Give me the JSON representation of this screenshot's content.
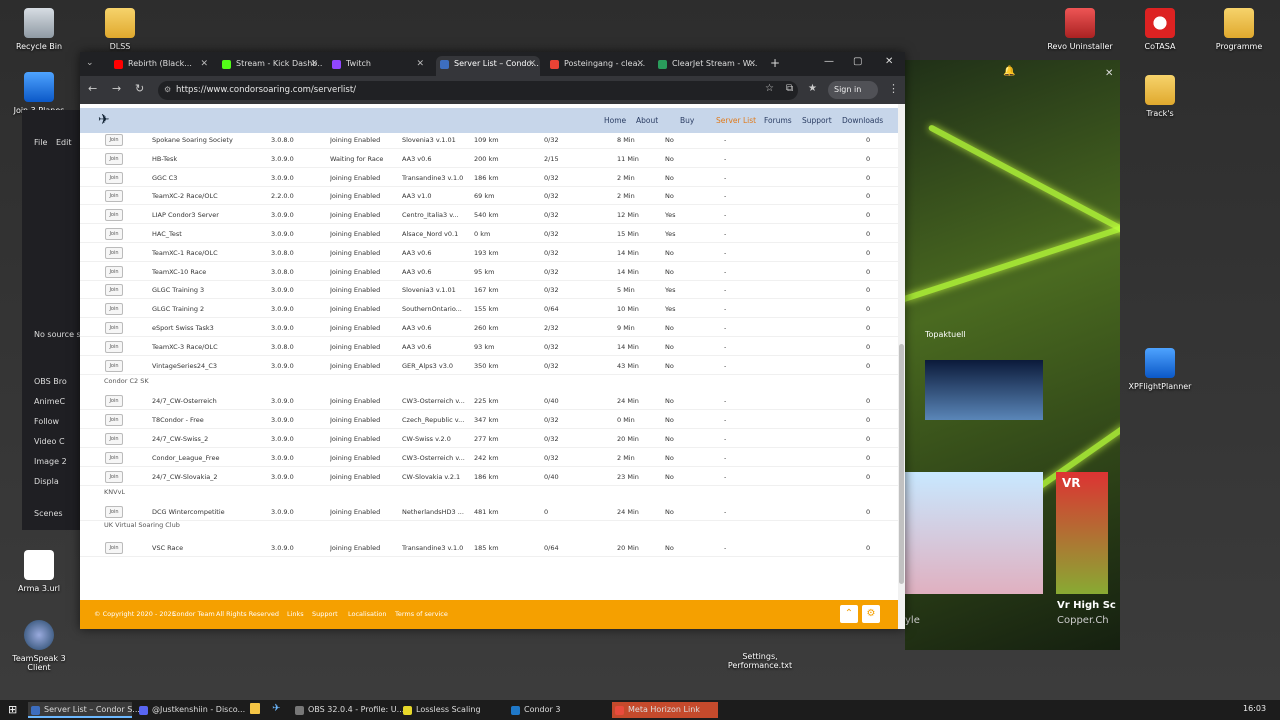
{
  "desktop": {
    "left_icons": [
      "Recycle Bin",
      "DLSS",
      "Join 3 Planes",
      "Arma 3.url",
      "TeamSpeak 3 Client"
    ],
    "right_icons": [
      "Revo Uninstaller",
      "CoTASA",
      "Programme",
      "Track's",
      "XPFlightPlanner",
      "Settings, Performance.txt"
    ]
  },
  "obs": {
    "menu": [
      "File",
      "Edit"
    ],
    "items": [
      "OBS Bro",
      "AnimeC",
      "Follow",
      "Video C",
      "Image 2",
      "Displa"
    ],
    "no_source": "No source s",
    "scenes_label": "Scenes"
  },
  "game": {
    "label": "Topaktuell",
    "vr_label": "VR",
    "promo_title": "Vr High Sc",
    "promo_sub": "Copper.Ch",
    "small": "yle"
  },
  "browser": {
    "tabs": [
      {
        "label": "Rebirth (Black...",
        "color": "#ff0000"
      },
      {
        "label": "Stream - Kick Dashb...",
        "color": "#53fc18"
      },
      {
        "label": "Twitch",
        "color": "#9146ff"
      },
      {
        "label": "Server List – Condo...",
        "color": "#3d6ebf",
        "active": true
      },
      {
        "label": "Posteingang - clea...",
        "color": "#ea4335"
      },
      {
        "label": "ClearJet Stream - W...",
        "color": "#2a9d5c"
      }
    ],
    "url": "https://www.condorsoaring.com/serverlist/",
    "signin": "Sign in",
    "nav": [
      "Home",
      "About",
      "Buy",
      "Server List",
      "Forums",
      "Support",
      "Downloads"
    ]
  },
  "servers": [
    {
      "name": "Spokane Soaring Society",
      "version": "3.0.8.0",
      "status": "Joining Enabled",
      "scenery": "Slovenia3 v.1.01",
      "dist": "109 km",
      "players": "0/32",
      "time": "8 Min",
      "pw": "No",
      "ext": "-",
      "ping": "0"
    },
    {
      "name": "HB-Tesk",
      "version": "3.0.9.0",
      "status": "Waiting for Race",
      "scenery": "AA3 v0.6",
      "dist": "200 km",
      "players": "2/15",
      "time": "11 Min",
      "pw": "No",
      "ext": "-",
      "ping": "0"
    },
    {
      "name": "GGC C3",
      "version": "3.0.9.0",
      "status": "Joining Enabled",
      "scenery": "Transandine3 v.1.0",
      "dist": "186 km",
      "players": "0/32",
      "time": "2 Min",
      "pw": "No",
      "ext": "-",
      "ping": "0"
    },
    {
      "name": "TeamXC-2 Race/OLC",
      "version": "2.2.0.0",
      "status": "Joining Enabled",
      "scenery": "AA3 v1.0",
      "dist": "69 km",
      "players": "0/32",
      "time": "2 Min",
      "pw": "No",
      "ext": "-",
      "ping": "0"
    },
    {
      "name": "LIAP Condor3 Server",
      "version": "3.0.9.0",
      "status": "Joining Enabled",
      "scenery": "Centro_Italia3 v...",
      "dist": "540 km",
      "players": "0/32",
      "time": "12 Min",
      "pw": "Yes",
      "ext": "-",
      "ping": "0"
    },
    {
      "name": "HAC_Test",
      "version": "3.0.9.0",
      "status": "Joining Enabled",
      "scenery": "Alsace_Nord v0.1",
      "dist": "0 km",
      "players": "0/32",
      "time": "15 Min",
      "pw": "Yes",
      "ext": "-",
      "ping": "0"
    },
    {
      "name": "TeamXC-1 Race/OLC",
      "version": "3.0.8.0",
      "status": "Joining Enabled",
      "scenery": "AA3 v0.6",
      "dist": "193 km",
      "players": "0/32",
      "time": "14 Min",
      "pw": "No",
      "ext": "-",
      "ping": "0"
    },
    {
      "name": "TeamXC-10 Race",
      "version": "3.0.8.0",
      "status": "Joining Enabled",
      "scenery": "AA3 v0.6",
      "dist": "95 km",
      "players": "0/32",
      "time": "14 Min",
      "pw": "No",
      "ext": "-",
      "ping": "0"
    },
    {
      "name": "GLGC Training 3",
      "version": "3.0.9.0",
      "status": "Joining Enabled",
      "scenery": "Slovenia3 v.1.01",
      "dist": "167 km",
      "players": "0/32",
      "time": "5 Min",
      "pw": "Yes",
      "ext": "-",
      "ping": "0"
    },
    {
      "name": "GLGC Training 2",
      "version": "3.0.9.0",
      "status": "Joining Enabled",
      "scenery": "SouthernOntario...",
      "dist": "155 km",
      "players": "0/64",
      "time": "10 Min",
      "pw": "Yes",
      "ext": "-",
      "ping": "0"
    },
    {
      "name": "eSport Swiss Task3",
      "version": "3.0.9.0",
      "status": "Joining Enabled",
      "scenery": "AA3 v0.6",
      "dist": "260 km",
      "players": "2/32",
      "time": "9 Min",
      "pw": "No",
      "ext": "-",
      "ping": "0"
    },
    {
      "name": "TeamXC-3 Race/OLC",
      "version": "3.0.8.0",
      "status": "Joining Enabled",
      "scenery": "AA3 v0.6",
      "dist": "93 km",
      "players": "0/32",
      "time": "14 Min",
      "pw": "No",
      "ext": "-",
      "ping": "0"
    },
    {
      "name": "VintageSeries24_C3",
      "version": "3.0.9.0",
      "status": "Joining Enabled",
      "scenery": "GER_Alps3 v3.0",
      "dist": "350 km",
      "players": "0/32",
      "time": "43 Min",
      "pw": "No",
      "ext": "-",
      "ping": "0"
    }
  ],
  "group2": {
    "title": "Condor C2 SK",
    "servers": [
      {
        "name": "24/7_CW-Osterreich",
        "version": "3.0.9.0",
        "status": "Joining Enabled",
        "scenery": "CW3-Osterreich v...",
        "dist": "225 km",
        "players": "0/40",
        "time": "24 Min",
        "pw": "No",
        "ext": "-",
        "ping": "0"
      },
      {
        "name": "T8Condor - Free",
        "version": "3.0.9.0",
        "status": "Joining Enabled",
        "scenery": "Czech_Republic v...",
        "dist": "347 km",
        "players": "0/32",
        "time": "0 Min",
        "pw": "No",
        "ext": "-",
        "ping": "0"
      },
      {
        "name": "24/7_CW-Swiss_2",
        "version": "3.0.9.0",
        "status": "Joining Enabled",
        "scenery": "CW-Swiss v.2.0",
        "dist": "277 km",
        "players": "0/32",
        "time": "20 Min",
        "pw": "No",
        "ext": "-",
        "ping": "0"
      },
      {
        "name": "Condor_League_Free",
        "version": "3.0.9.0",
        "status": "Joining Enabled",
        "scenery": "CW3-Osterreich v...",
        "dist": "242 km",
        "players": "0/32",
        "time": "2 Min",
        "pw": "No",
        "ext": "-",
        "ping": "0"
      },
      {
        "name": "24/7_CW-Slovakia_2",
        "version": "3.0.9.0",
        "status": "Joining Enabled",
        "scenery": "CW-Slovakia v.2.1",
        "dist": "186 km",
        "players": "0/40",
        "time": "23 Min",
        "pw": "No",
        "ext": "-",
        "ping": "0"
      }
    ]
  },
  "group3": {
    "title": "KNVvL",
    "servers": [
      {
        "name": "DCG Wintercompetitie",
        "version": "3.0.9.0",
        "status": "Joining Enabled",
        "scenery": "NetherlandsHD3 ...",
        "dist": "481 km",
        "players": "0",
        "time": "24 Min",
        "pw": "No",
        "ext": "-",
        "ping": "0"
      }
    ]
  },
  "group4": {
    "title": "UK Virtual Soaring Club",
    "servers": [
      {
        "name": "VSC Race",
        "version": "3.0.9.0",
        "status": "Joining Enabled",
        "scenery": "Transandine3 v.1.0",
        "dist": "185 km",
        "players": "0/64",
        "time": "20 Min",
        "pw": "No",
        "ext": "-",
        "ping": "0"
      }
    ]
  },
  "join_label": "Join",
  "footer": {
    "copyright": "© Copyright 2020 - 2025",
    "team": "Condor Team",
    "rights": "All Rights Reserved",
    "links": [
      "Links",
      "Support",
      "Localisation",
      "Terms of service"
    ]
  },
  "taskbar": {
    "items": [
      {
        "label": "Server List – Condor S...",
        "color": "#3d6ebf",
        "active": true
      },
      {
        "label": "@Justkenshiin - Disco...",
        "color": "#5865f2"
      },
      {
        "label": "OBS 32.0.4 - Profile: U...",
        "color": "#777"
      },
      {
        "label": "Lossless Scaling",
        "color": "#e7d82a"
      },
      {
        "label": "Condor 3",
        "color": "#1f78c8"
      },
      {
        "label": "Meta Horizon Link",
        "color": "#e94b3c",
        "hl": true
      }
    ],
    "clock": "16:03"
  }
}
